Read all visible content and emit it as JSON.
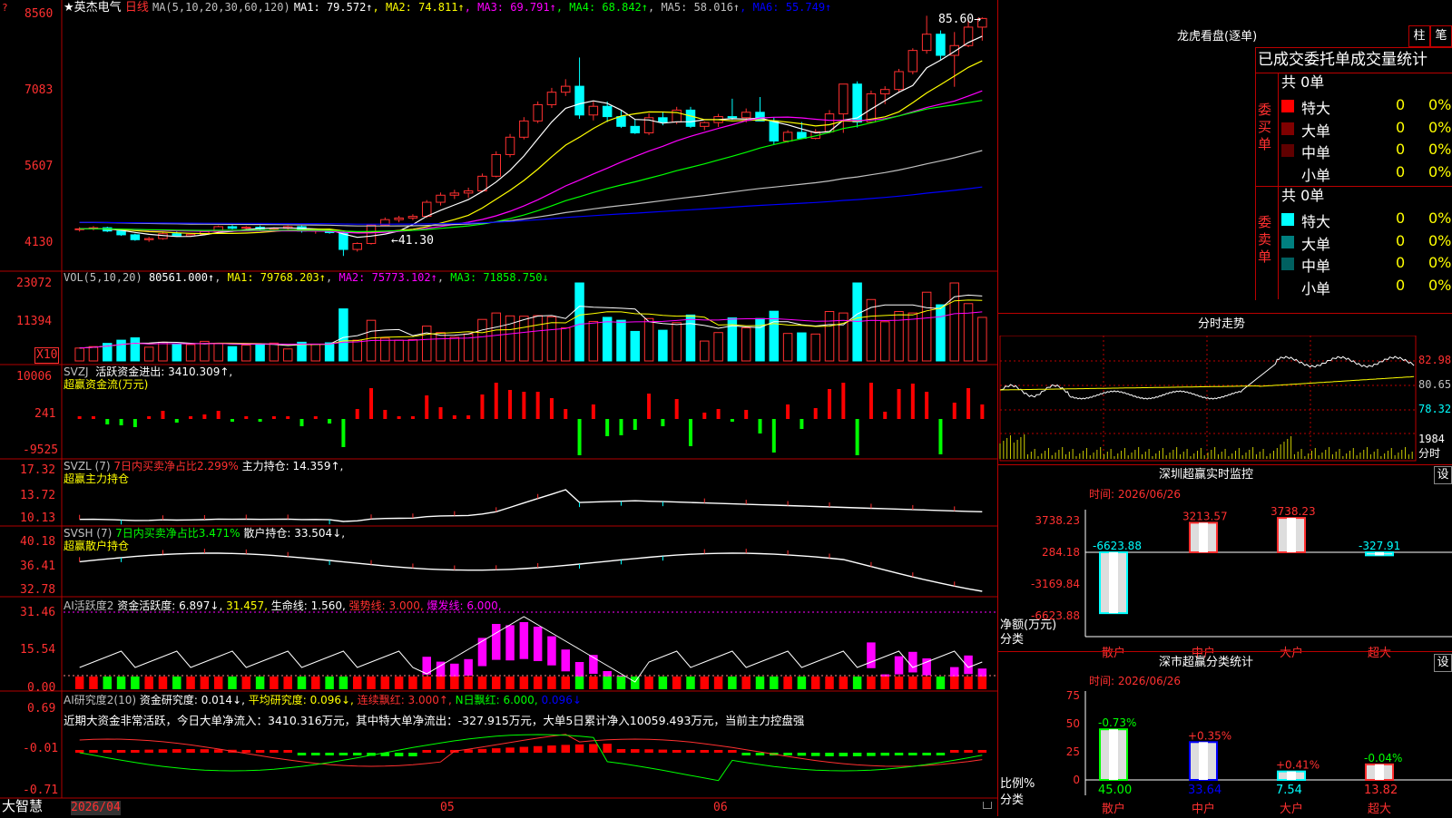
{
  "header": {
    "star": "★",
    "stock_name": "英杰电气",
    "period": "日线",
    "ma_label": "MA(5,10,20,30,60,120)",
    "ma_values": [
      {
        "text": "MA1: 79.572↑",
        "color": "#ffffff"
      },
      {
        "text": "MA2: 74.811↑",
        "color": "#ffff00"
      },
      {
        "text": "MA3: 69.791↑",
        "color": "#ff00ff"
      },
      {
        "text": "MA4: 68.842↑",
        "color": "#00ff00"
      },
      {
        "text": "MA5: 58.016↑",
        "color": "#c0c0c0"
      },
      {
        "text": "MA6: 55.749↑",
        "color": "#0000ff"
      }
    ],
    "price_axis": [
      "8560",
      "7083",
      "5607",
      "4130"
    ],
    "high_note": "85.60",
    "low_note": "41.30"
  },
  "vol": {
    "title": "VOL(5,10,20)",
    "value": "80561.000↑",
    "ma1": "MA1: 79768.203↑",
    "ma2": "MA2: 75773.102↑",
    "ma3": "MA3: 71858.750↓",
    "axis": [
      "23072",
      "11394"
    ],
    "unit": "X10"
  },
  "svzj": {
    "title": "SVZJ",
    "label": "活跃资金进出: 3410.309↑,",
    "sub": "超赢资金流(万元)",
    "axis": [
      "10006",
      "241",
      "-9525"
    ]
  },
  "svzl": {
    "title": "SVZL  (7)",
    "pct": "7日内买卖净占比2.299%",
    "label": "主力持仓: 14.359↑,",
    "sub": "超赢主力持仓",
    "axis": [
      "17.32",
      "13.72",
      "10.13"
    ]
  },
  "svsh": {
    "title": "SVSH  (7)",
    "pct": "7日内买卖净占比3.471%",
    "label": "散户持仓: 33.504↓,",
    "sub": "超赢散户持仓",
    "axis": [
      "40.18",
      "36.41",
      "32.78"
    ]
  },
  "ai1": {
    "title": "AI活跃度2",
    "label": "资金活跃度: 6.897↓,",
    "v2": "31.457,",
    "v3": "生命线: 1.560,",
    "v4": "强势线: 3.000,",
    "v5": "爆发线: 6.000,",
    "axis": [
      "31.46",
      "15.54",
      "0.00"
    ]
  },
  "ai2": {
    "title": "AI研究度2(10)",
    "label": "资金研究度: 0.014↓,",
    "v2": "平均研究度: 0.096↓,",
    "v3": "连续飘红: 3.000↑,",
    "v4": "N日飘红: 6.000,",
    "v5": "0.096↓",
    "comment": "近期大资金非常活跃，今日大单净流入：3410.316万元，其中特大单净流出：-327.915万元，大单5日累计净入10059.493万元，当前主力控盘强",
    "axis": [
      "0.69",
      "-0.01",
      "-0.71"
    ]
  },
  "footer": {
    "brand": "大智慧",
    "dates": [
      "2026/04",
      "05",
      "06"
    ]
  },
  "lhb": {
    "title": "龙虎看盘(逐单)",
    "btn1": "柱",
    "btn2": "笔",
    "subtitle": "已成交委托单成交量统计",
    "buy_label": "委买单",
    "sell_label": "委卖单",
    "buy_total": "共 0单",
    "sell_total": "共 0单",
    "buy_rows": [
      {
        "name": "特大",
        "count": "0",
        "pct": "0%",
        "color": "#ff0000"
      },
      {
        "name": "大单",
        "count": "0",
        "pct": "0%",
        "color": "#800000"
      },
      {
        "name": "中单",
        "count": "0",
        "pct": "0%",
        "color": "#600000"
      },
      {
        "name": "小单",
        "count": "0",
        "pct": "0%",
        "color": "#000000"
      }
    ],
    "sell_rows": [
      {
        "name": "特大",
        "count": "0",
        "pct": "0%",
        "color": "#00ffff"
      },
      {
        "name": "大单",
        "count": "0",
        "pct": "0%",
        "color": "#008080"
      },
      {
        "name": "中单",
        "count": "0",
        "pct": "0%",
        "color": "#006060"
      },
      {
        "name": "小单",
        "count": "0",
        "pct": "0%",
        "color": "#000000"
      }
    ]
  },
  "intraday": {
    "title": "分时走势",
    "axis": [
      "82.98",
      "80.65",
      "78.32"
    ],
    "vol_axis": "1984",
    "vol_unit": "分时"
  },
  "szmon": {
    "title": "深圳超赢实时监控",
    "btn": "设",
    "time": "时间: 2026/06/26",
    "axis": [
      "3738.23",
      "284.18",
      "-3169.84",
      "-6623.88"
    ],
    "ylab": "净额(万元)",
    "xlab": "分类",
    "cats": [
      "散户",
      "中户",
      "大户",
      "超大"
    ],
    "vals": [
      "-6623.88",
      "3213.57",
      "3738.23",
      "-327.91"
    ]
  },
  "szcls": {
    "title": "深市超赢分类统计",
    "btn": "设",
    "time": "时间: 2026/06/26",
    "axis": [
      "75",
      "50",
      "25",
      "0"
    ],
    "ylab": "比例%",
    "xlab": "分类",
    "cats": [
      "散户",
      "中户",
      "大户",
      "超大"
    ],
    "changes": [
      "-0.73%",
      "+0.35%",
      "+0.41%",
      "-0.04%"
    ],
    "vals": [
      "45.00",
      "33.64",
      "7.54",
      "13.82"
    ]
  },
  "chart_data": {
    "type": "candlestick",
    "title": "英杰电气 日线",
    "ylim": [
      41.3,
      85.6
    ],
    "candles": [
      [
        46.2,
        46.6,
        45.8,
        46.3
      ],
      [
        46.3,
        46.8,
        46.0,
        46.5
      ],
      [
        46.5,
        46.7,
        45.7,
        45.9
      ],
      [
        45.9,
        46.2,
        45.0,
        45.2
      ],
      [
        45.2,
        45.4,
        44.1,
        44.3
      ],
      [
        44.3,
        44.8,
        43.9,
        44.5
      ],
      [
        44.5,
        45.6,
        44.3,
        45.4
      ],
      [
        45.4,
        45.8,
        44.9,
        45.0
      ],
      [
        45.0,
        45.5,
        44.8,
        45.3
      ],
      [
        45.3,
        46.0,
        45.1,
        45.8
      ],
      [
        45.8,
        46.9,
        45.6,
        46.7
      ],
      [
        46.7,
        47.0,
        46.2,
        46.4
      ],
      [
        46.4,
        46.8,
        46.0,
        46.6
      ],
      [
        46.6,
        46.9,
        46.1,
        46.3
      ],
      [
        46.3,
        46.6,
        45.9,
        46.4
      ],
      [
        46.4,
        46.9,
        46.2,
        46.7
      ],
      [
        46.7,
        46.9,
        45.6,
        45.9
      ],
      [
        45.9,
        46.3,
        45.4,
        46.1
      ],
      [
        46.1,
        46.3,
        45.4,
        45.6
      ],
      [
        45.6,
        45.9,
        41.3,
        42.5
      ],
      [
        42.5,
        43.8,
        42.1,
        43.6
      ],
      [
        43.6,
        47.2,
        43.4,
        47.0
      ],
      [
        47.0,
        48.4,
        46.8,
        48.0
      ],
      [
        48.0,
        48.7,
        47.5,
        48.3
      ],
      [
        48.3,
        49.0,
        47.9,
        48.6
      ],
      [
        48.6,
        51.6,
        48.3,
        51.2
      ],
      [
        51.2,
        53.0,
        50.6,
        52.5
      ],
      [
        52.5,
        53.5,
        51.8,
        52.9
      ],
      [
        52.9,
        53.9,
        52.0,
        53.3
      ],
      [
        53.3,
        56.5,
        53.1,
        56.0
      ],
      [
        56.0,
        60.6,
        55.8,
        60.0
      ],
      [
        60.0,
        63.8,
        59.5,
        63.2
      ],
      [
        63.2,
        66.9,
        62.8,
        66.2
      ],
      [
        66.2,
        69.8,
        65.8,
        69.2
      ],
      [
        69.2,
        72.3,
        68.6,
        71.5
      ],
      [
        71.5,
        73.9,
        70.8,
        72.6
      ],
      [
        72.6,
        77.9,
        66.6,
        67.3
      ],
      [
        67.3,
        69.8,
        66.3,
        68.9
      ],
      [
        68.9,
        69.8,
        66.0,
        67.0
      ],
      [
        67.0,
        68.2,
        64.9,
        65.2
      ],
      [
        65.2,
        66.5,
        63.8,
        64.0
      ],
      [
        64.0,
        67.6,
        63.6,
        66.8
      ],
      [
        66.8,
        67.9,
        65.4,
        66.0
      ],
      [
        66.0,
        68.8,
        65.6,
        68.2
      ],
      [
        68.2,
        68.8,
        64.9,
        65.2
      ],
      [
        65.2,
        66.1,
        64.5,
        65.9
      ],
      [
        65.9,
        67.5,
        65.1,
        67.0
      ],
      [
        67.0,
        70.3,
        66.4,
        66.8
      ],
      [
        66.8,
        68.5,
        65.9,
        67.8
      ],
      [
        67.8,
        70.6,
        67.1,
        66.2
      ],
      [
        66.2,
        66.8,
        61.8,
        62.5
      ],
      [
        62.5,
        64.5,
        62.2,
        64.1
      ],
      [
        64.1,
        66.0,
        63.8,
        63.0
      ],
      [
        63.0,
        64.7,
        62.8,
        64.2
      ],
      [
        64.2,
        68.2,
        63.9,
        67.5
      ],
      [
        67.5,
        68.8,
        64.0,
        73.0
      ],
      [
        73.0,
        73.5,
        65.0,
        66.0
      ],
      [
        66.0,
        71.8,
        65.8,
        71.2
      ],
      [
        71.2,
        72.6,
        69.3,
        72.0
      ],
      [
        72.0,
        75.8,
        71.5,
        75.3
      ],
      [
        75.3,
        79.6,
        74.8,
        79.2
      ],
      [
        79.2,
        85.6,
        78.6,
        82.2
      ],
      [
        82.2,
        82.9,
        77.5,
        78.3
      ],
      [
        78.3,
        82.6,
        72.5,
        80.1
      ],
      [
        80.1,
        85.0,
        79.8,
        83.5
      ],
      [
        83.5,
        85.3,
        81.0,
        85.1
      ]
    ]
  }
}
